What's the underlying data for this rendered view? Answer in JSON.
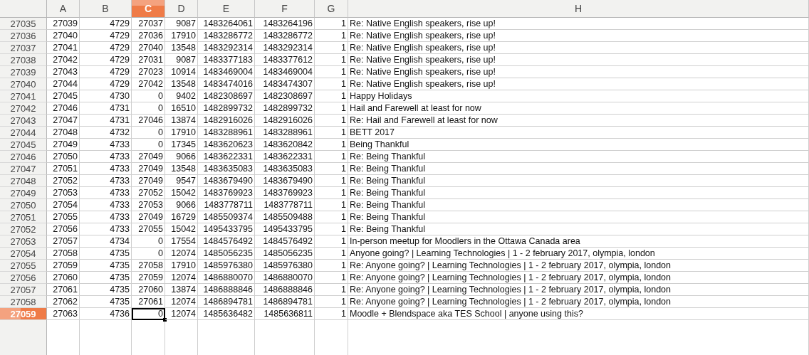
{
  "columns": [
    {
      "label": "A",
      "kind": "number",
      "selected": false
    },
    {
      "label": "B",
      "kind": "number",
      "selected": false
    },
    {
      "label": "C",
      "kind": "number",
      "selected": true
    },
    {
      "label": "D",
      "kind": "number",
      "selected": false
    },
    {
      "label": "E",
      "kind": "number",
      "selected": false
    },
    {
      "label": "F",
      "kind": "number",
      "selected": false
    },
    {
      "label": "G",
      "kind": "number",
      "selected": false
    },
    {
      "label": "H",
      "kind": "text",
      "selected": false
    }
  ],
  "rows": [
    {
      "header": "27035",
      "selected": false,
      "cells": [
        "27039",
        "4729",
        "27037",
        "9087",
        "1483264061",
        "1483264196",
        "1",
        "Re: Native English speakers, rise up!"
      ]
    },
    {
      "header": "27036",
      "selected": false,
      "cells": [
        "27040",
        "4729",
        "27036",
        "17910",
        "1483286772",
        "1483286772",
        "1",
        "Re: Native English speakers, rise up!"
      ]
    },
    {
      "header": "27037",
      "selected": false,
      "cells": [
        "27041",
        "4729",
        "27040",
        "13548",
        "1483292314",
        "1483292314",
        "1",
        "Re: Native English speakers, rise up!"
      ]
    },
    {
      "header": "27038",
      "selected": false,
      "cells": [
        "27042",
        "4729",
        "27031",
        "9087",
        "1483377183",
        "1483377612",
        "1",
        "Re: Native English speakers, rise up!"
      ]
    },
    {
      "header": "27039",
      "selected": false,
      "cells": [
        "27043",
        "4729",
        "27023",
        "10914",
        "1483469004",
        "1483469004",
        "1",
        "Re: Native English speakers, rise up!"
      ]
    },
    {
      "header": "27040",
      "selected": false,
      "cells": [
        "27044",
        "4729",
        "27042",
        "13548",
        "1483474016",
        "1483474307",
        "1",
        "Re: Native English speakers, rise up!"
      ]
    },
    {
      "header": "27041",
      "selected": false,
      "cells": [
        "27045",
        "4730",
        "0",
        "9402",
        "1482308697",
        "1482308697",
        "1",
        "Happy Holidays"
      ]
    },
    {
      "header": "27042",
      "selected": false,
      "cells": [
        "27046",
        "4731",
        "0",
        "16510",
        "1482899732",
        "1482899732",
        "1",
        "Hail and Farewell at least for now"
      ]
    },
    {
      "header": "27043",
      "selected": false,
      "cells": [
        "27047",
        "4731",
        "27046",
        "13874",
        "1482916026",
        "1482916026",
        "1",
        "Re: Hail and Farewell at least for now"
      ]
    },
    {
      "header": "27044",
      "selected": false,
      "cells": [
        "27048",
        "4732",
        "0",
        "17910",
        "1483288961",
        "1483288961",
        "1",
        "BETT 2017"
      ]
    },
    {
      "header": "27045",
      "selected": false,
      "cells": [
        "27049",
        "4733",
        "0",
        "17345",
        "1483620623",
        "1483620842",
        "1",
        "Being Thankful"
      ]
    },
    {
      "header": "27046",
      "selected": false,
      "cells": [
        "27050",
        "4733",
        "27049",
        "9066",
        "1483622331",
        "1483622331",
        "1",
        "Re: Being Thankful"
      ]
    },
    {
      "header": "27047",
      "selected": false,
      "cells": [
        "27051",
        "4733",
        "27049",
        "13548",
        "1483635083",
        "1483635083",
        "1",
        "Re: Being Thankful"
      ]
    },
    {
      "header": "27048",
      "selected": false,
      "cells": [
        "27052",
        "4733",
        "27049",
        "9547",
        "1483679490",
        "1483679490",
        "1",
        "Re: Being Thankful"
      ]
    },
    {
      "header": "27049",
      "selected": false,
      "cells": [
        "27053",
        "4733",
        "27052",
        "15042",
        "1483769923",
        "1483769923",
        "1",
        "Re: Being Thankful"
      ]
    },
    {
      "header": "27050",
      "selected": false,
      "cells": [
        "27054",
        "4733",
        "27053",
        "9066",
        "1483778711",
        "1483778711",
        "1",
        "Re: Being Thankful"
      ]
    },
    {
      "header": "27051",
      "selected": false,
      "cells": [
        "27055",
        "4733",
        "27049",
        "16729",
        "1485509374",
        "1485509488",
        "1",
        "Re: Being Thankful"
      ]
    },
    {
      "header": "27052",
      "selected": false,
      "cells": [
        "27056",
        "4733",
        "27055",
        "15042",
        "1495433795",
        "1495433795",
        "1",
        "Re: Being Thankful"
      ]
    },
    {
      "header": "27053",
      "selected": false,
      "cells": [
        "27057",
        "4734",
        "0",
        "17554",
        "1484576492",
        "1484576492",
        "1",
        "In-person meetup for Moodlers in the Ottawa Canada area"
      ]
    },
    {
      "header": "27054",
      "selected": false,
      "cells": [
        "27058",
        "4735",
        "0",
        "12074",
        "1485056235",
        "1485056235",
        "1",
        "Anyone going? | Learning Technologies | 1 - 2 february 2017, olympia, london"
      ]
    },
    {
      "header": "27055",
      "selected": false,
      "cells": [
        "27059",
        "4735",
        "27058",
        "17910",
        "1485976380",
        "1485976380",
        "1",
        "Re: Anyone going? | Learning Technologies | 1 - 2 february 2017, olympia, london"
      ]
    },
    {
      "header": "27056",
      "selected": false,
      "cells": [
        "27060",
        "4735",
        "27059",
        "12074",
        "1486880070",
        "1486880070",
        "1",
        "Re: Anyone going? | Learning Technologies | 1 - 2 february 2017, olympia, london"
      ]
    },
    {
      "header": "27057",
      "selected": false,
      "cells": [
        "27061",
        "4735",
        "27060",
        "13874",
        "1486888846",
        "1486888846",
        "1",
        "Re: Anyone going? | Learning Technologies | 1 - 2 february 2017, olympia, london"
      ]
    },
    {
      "header": "27058",
      "selected": false,
      "cells": [
        "27062",
        "4735",
        "27061",
        "12074",
        "1486894781",
        "1486894781",
        "1",
        "Re: Anyone going? | Learning Technologies | 1 - 2 february 2017, olympia, london"
      ]
    },
    {
      "header": "27059",
      "selected": true,
      "cells": [
        "27063",
        "4736",
        "0",
        "12074",
        "1485636482",
        "1485636811",
        "1",
        "Moodle + Blendspace aka TES School | anyone using this?"
      ]
    }
  ]
}
